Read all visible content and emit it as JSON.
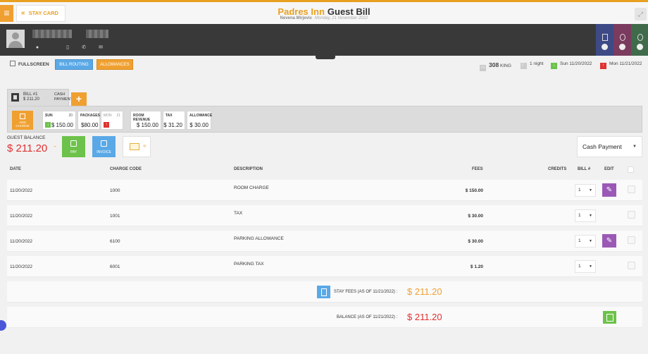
{
  "header": {
    "stay_card_label": "STAY CARD",
    "hotel_name": "Padres Inn",
    "page_title": "Guest Bill",
    "guest_name": "Nevena Mirjevic",
    "date": "Monday, 21 November 2022"
  },
  "icons": {
    "menu": "hamburger-icon",
    "back": "double-chevron-left-icon",
    "location": "map-pin-icon",
    "mobile": "mobile-phone-icon",
    "phone": "phone-icon",
    "mail": "mail-icon",
    "fullscreen": "fullscreen-icon"
  },
  "colors": {
    "accent_orange": "#f0a030",
    "blue": "#5aa9e6",
    "green": "#6cc24a",
    "purple": "#9b59b6",
    "red": "#e03030",
    "dark_band": "#393939"
  },
  "toolbar": {
    "fullscreen_label": "FULLSCREEN",
    "bill_routing_label": "BILL ROUTING",
    "allowances_label": "ALLOWANCES",
    "room_number": "308",
    "room_type": "KING",
    "nights": "1 night",
    "arrival": "Sun 11/20/2022",
    "departure": "Mon 11/21/2022"
  },
  "bill": {
    "tab_label": "BILL #1",
    "tab_amount": "$ 211.20",
    "payment_line1": "CASH",
    "payment_line2": "PAYMENT",
    "add_charge_line1": "ADD",
    "add_charge_line2": "CHARGE"
  },
  "summary": {
    "sun_label": "SUN",
    "sun_day": "20",
    "sun_value": "$ 150.00",
    "packages_label": "PACKAGES",
    "packages_value": "$80.00",
    "mon_label": "MON",
    "mon_day": "21",
    "room_revenue_label": "ROOM REVENUE",
    "room_revenue_value": "$ 150.00",
    "tax_label": "TAX",
    "tax_value": "$ 31.20",
    "allowance_label": "ALLOWANCE",
    "allowance_value": "$ 30.00"
  },
  "balance": {
    "label": "GUEST BALANCE",
    "amount": "$ 211.20",
    "pay_label": "PAY",
    "invoice_label": "INVOICE",
    "payment_method": "Cash Payment"
  },
  "table": {
    "headers": {
      "date": "DATE",
      "charge_code": "CHARGE CODE",
      "description": "DESCRIPTION",
      "fees": "FEES",
      "credits": "CREDITS",
      "bill": "BILL #",
      "edit": "EDIT"
    },
    "rows": [
      {
        "date": "11/20/2022",
        "code": "1000",
        "description": "ROOM CHARGE",
        "fee": "$ 150.00",
        "bill": "1"
      },
      {
        "date": "11/20/2022",
        "code": "1001",
        "description": "TAX",
        "fee": "$ 30.00",
        "bill": "1"
      },
      {
        "date": "11/20/2022",
        "code": "6100",
        "description": "PARKING ALLOWANCE",
        "fee": "$ 30.00",
        "bill": "1"
      },
      {
        "date": "11/20/2022",
        "code": "6001",
        "description": "PARKING TAX",
        "fee": "$ 1.20",
        "bill": "1"
      }
    ]
  },
  "totals": {
    "stay_fees_label": "STAY FEES (AS OF  11/21/2022) :",
    "stay_fees_amount": "$ 211.20",
    "balance_label": "BALANCE (AS OF  11/21/2022) :",
    "balance_amount": "$ 211.20"
  }
}
